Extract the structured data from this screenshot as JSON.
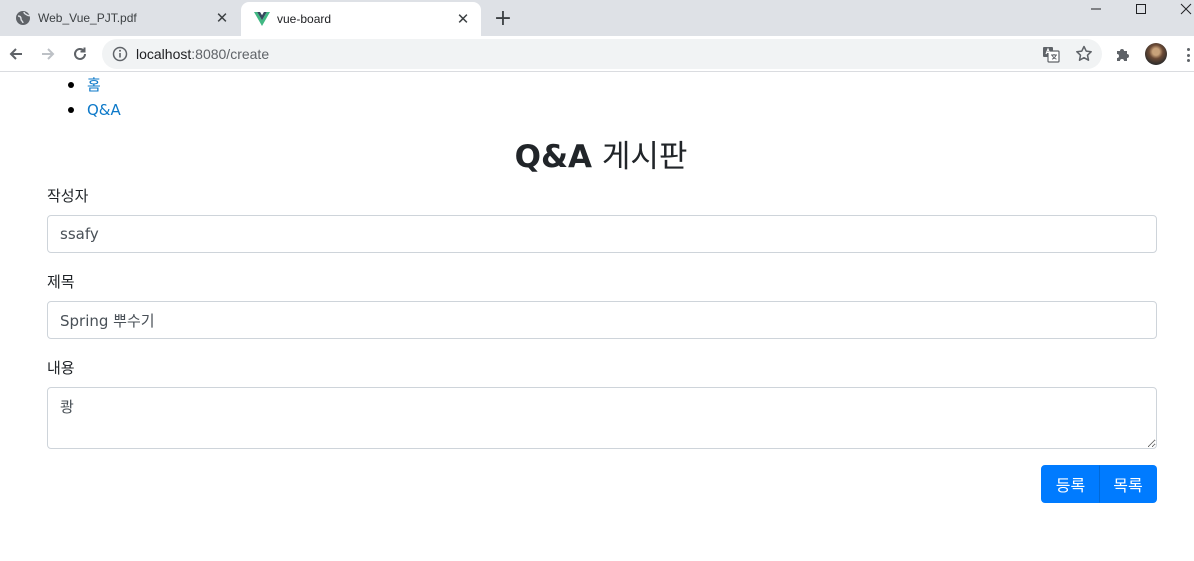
{
  "browser": {
    "tabs": [
      {
        "title": "Web_Vue_PJT.pdf",
        "icon": "globe-icon",
        "active": false
      },
      {
        "title": "vue-board",
        "icon": "vue-logo-icon",
        "active": true
      }
    ],
    "new_tab_symbol": "+",
    "close_symbol": "✕",
    "url_host": "localhost",
    "url_rest": ":8080/create"
  },
  "nav": {
    "items": [
      {
        "label": "홈"
      },
      {
        "label": "Q&A"
      }
    ]
  },
  "page": {
    "title_bold": "Q&A",
    "title_rest": " 게시판"
  },
  "form": {
    "writer_label": "작성자",
    "writer_value": "ssafy",
    "title_label": "제목",
    "title_value": "Spring 뿌수기",
    "content_label": "내용",
    "content_value": "쾅",
    "register_button": "등록",
    "list_button": "목록"
  },
  "colors": {
    "primary": "#007bff",
    "link": "#0d79c9",
    "tabstrip": "#dee1e6"
  }
}
